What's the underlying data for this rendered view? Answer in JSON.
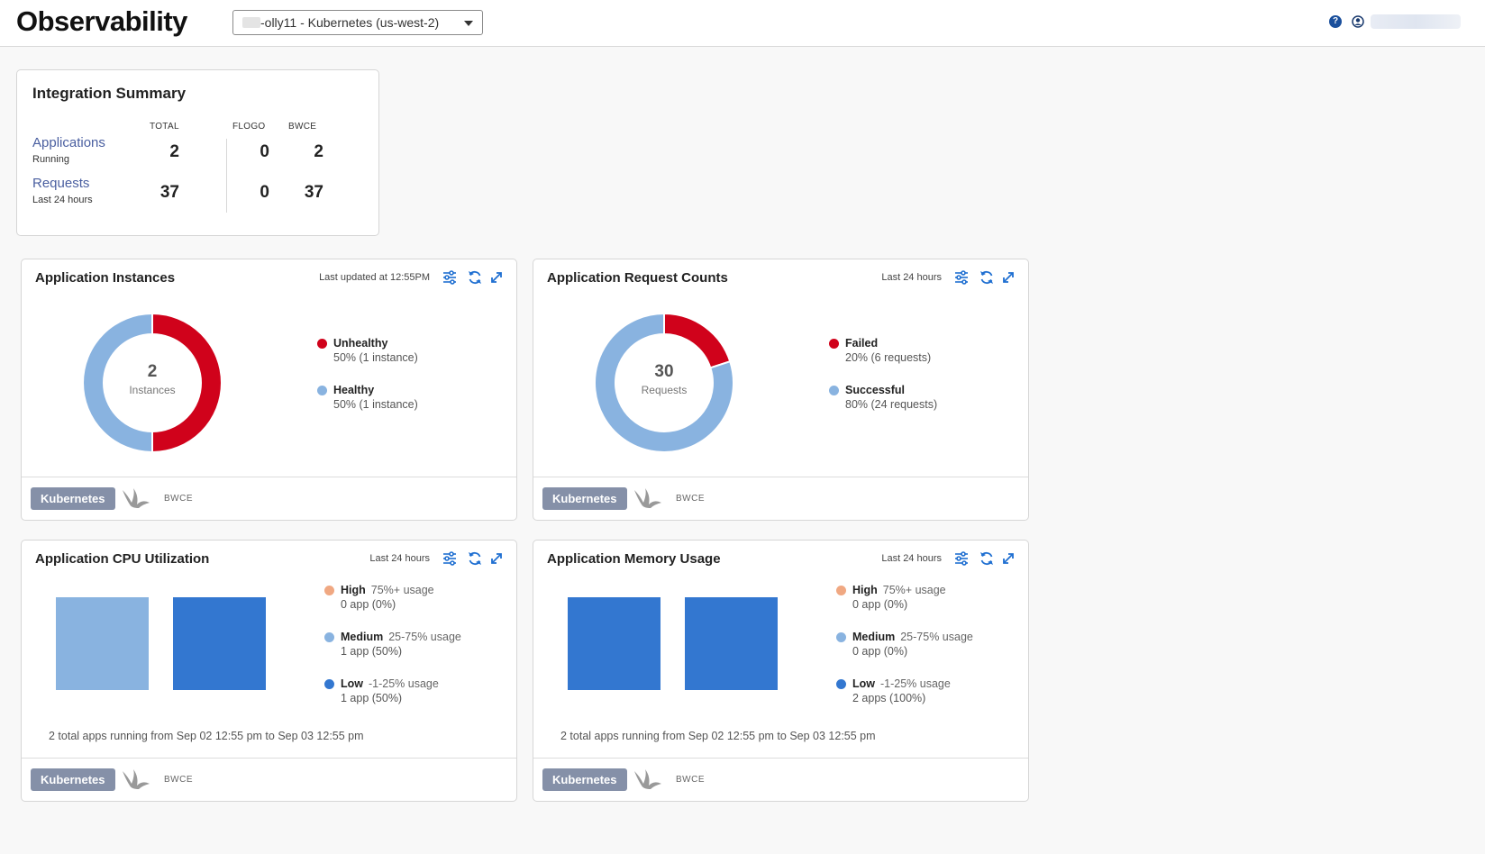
{
  "header": {
    "title": "Observability",
    "environment": "-olly11 - Kubernetes (us-west-2)",
    "help_icon": "question-circle-icon",
    "user_icon": "user-circle-icon"
  },
  "summary": {
    "title": "Integration Summary",
    "columns": [
      "TOTAL",
      "FLOGO",
      "BWCE"
    ],
    "rows": [
      {
        "label": "Applications",
        "sub": "Running",
        "values": [
          "2",
          "0",
          "2"
        ]
      },
      {
        "label": "Requests",
        "sub": "Last 24 hours",
        "values": [
          "37",
          "0",
          "37"
        ]
      }
    ]
  },
  "colors": {
    "red": "#d0021b",
    "light_blue": "#89b3e0",
    "blue": "#3377d0",
    "orange": "#f0a882"
  },
  "widgets": {
    "instances": {
      "title": "Application Instances",
      "meta": "Last updated at 12:55PM",
      "center_value": "2",
      "center_label": "Instances",
      "legend": [
        {
          "name": "Unhealthy",
          "value": "50% (1 instance)",
          "fraction": 0.5
        },
        {
          "name": "Healthy",
          "value": "50% (1 instance)",
          "fraction": 0.5
        }
      ]
    },
    "requests": {
      "title": "Application Request Counts",
      "meta": "Last 24 hours",
      "center_value": "30",
      "center_label": "Requests",
      "legend": [
        {
          "name": "Failed",
          "value": "20% (6 requests)",
          "fraction": 0.2
        },
        {
          "name": "Successful",
          "value": "80% (24 requests)",
          "fraction": 0.8
        }
      ]
    },
    "cpu": {
      "title": "Application CPU Utilization",
      "meta": "Last 24 hours",
      "legend": [
        {
          "name": "High",
          "range": "75%+ usage",
          "value": "0 app (0%)"
        },
        {
          "name": "Medium",
          "range": "25-75% usage",
          "value": "1 app (50%)"
        },
        {
          "name": "Low",
          "range": "-1-25% usage",
          "value": "1 app (50%)"
        }
      ],
      "bar_levels": [
        "Medium",
        "Low"
      ],
      "note": "2 total apps running from Sep 02 12:55 pm to Sep 03 12:55 pm"
    },
    "memory": {
      "title": "Application Memory Usage",
      "meta": "Last 24 hours",
      "legend": [
        {
          "name": "High",
          "range": "75%+ usage",
          "value": "0 app (0%)"
        },
        {
          "name": "Medium",
          "range": "25-75% usage",
          "value": "0 app (0%)"
        },
        {
          "name": "Low",
          "range": "-1-25% usage",
          "value": "2 apps (100%)"
        }
      ],
      "bar_levels": [
        "Low",
        "Low"
      ],
      "note": "2 total apps running from Sep 02 12:55 pm to Sep 03 12:55 pm"
    }
  },
  "footer": {
    "platform_button": "Kubernetes",
    "runtime_tag": "BWCE",
    "bird_icon": "tibco-bird-icon"
  },
  "toolbar_icons": [
    "filter-sliders-icon",
    "refresh-icon",
    "expand-icon"
  ]
}
